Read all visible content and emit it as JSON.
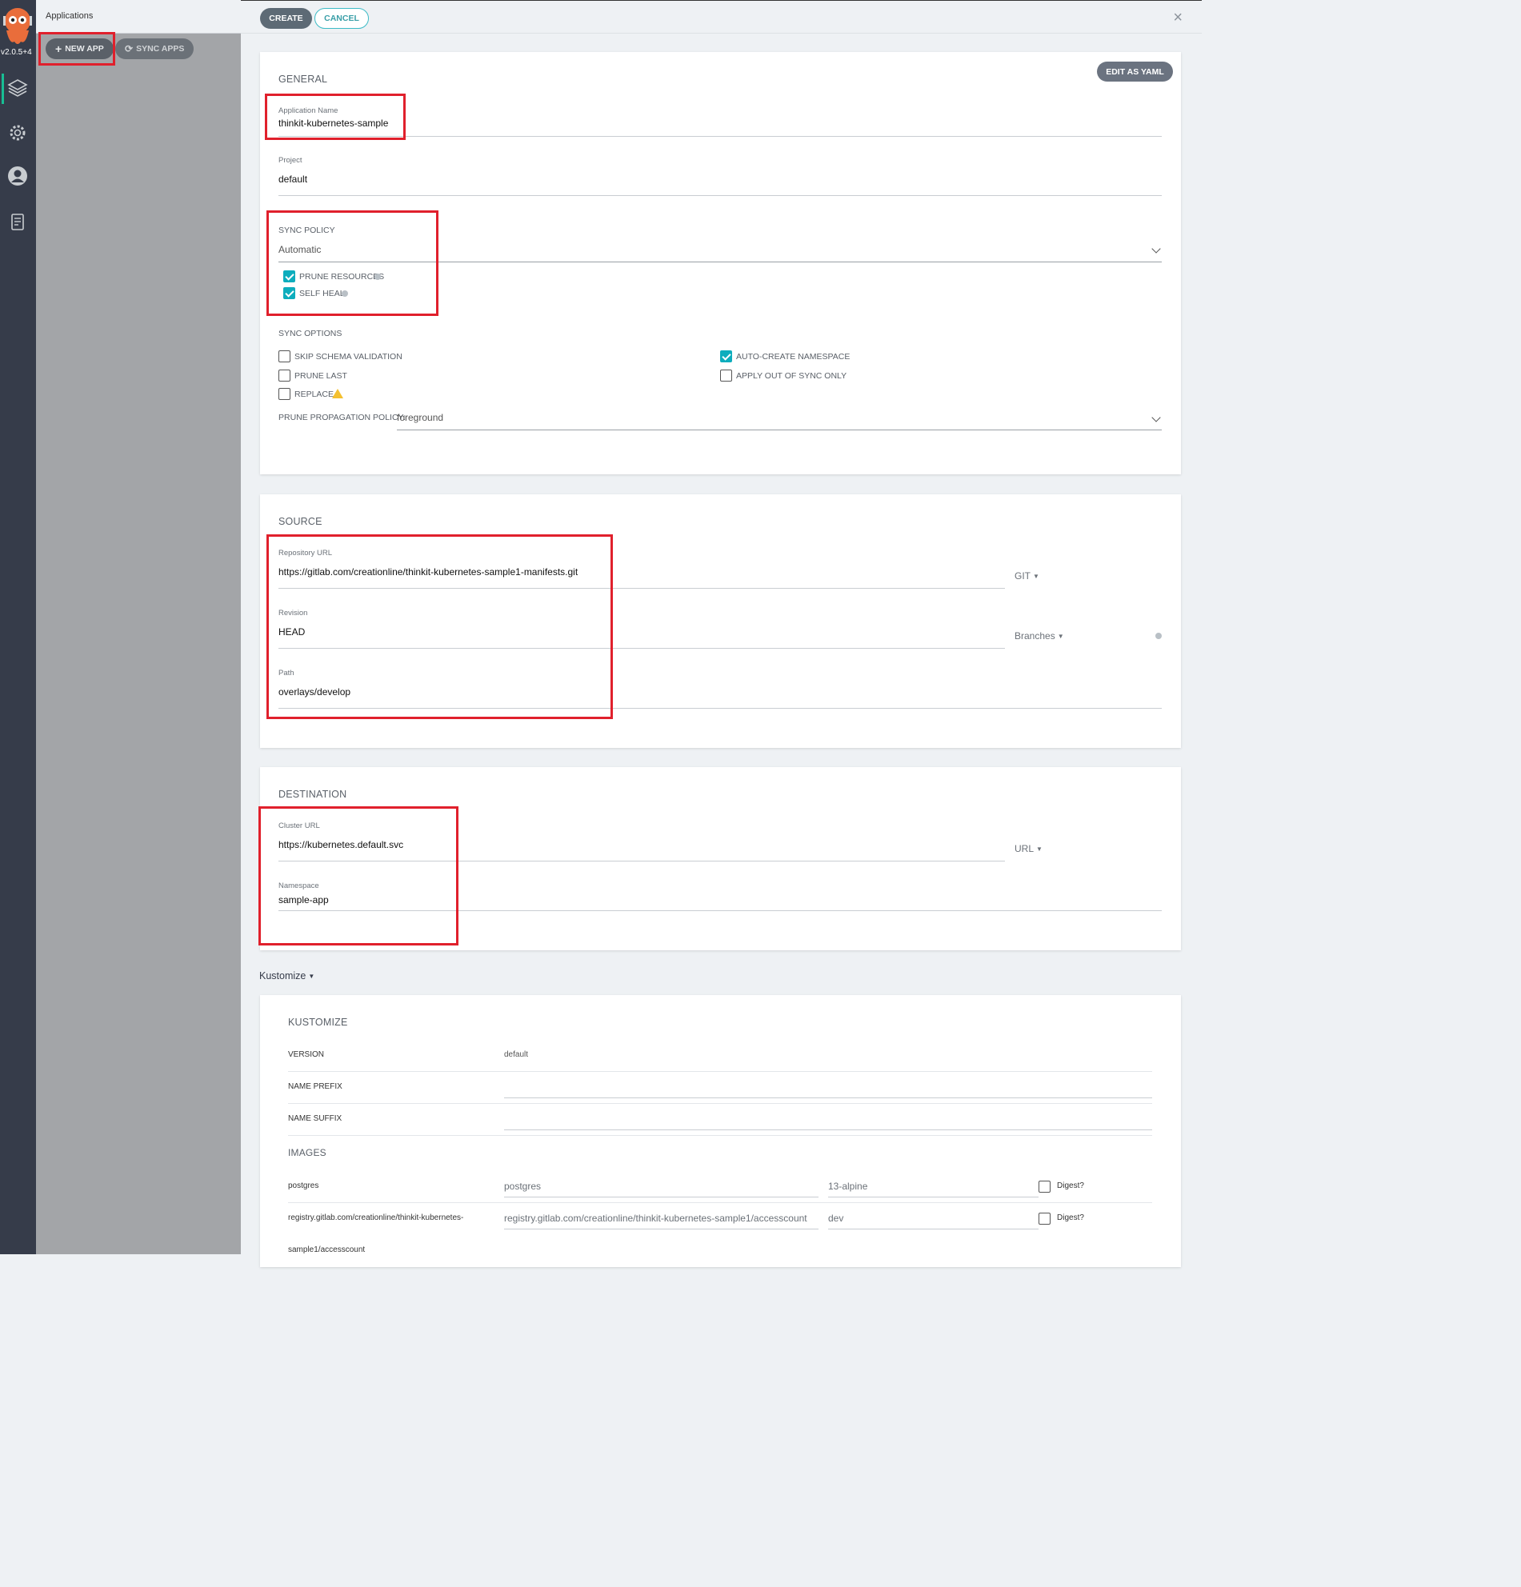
{
  "nav": {
    "version": "v2.0.5+4",
    "items": [
      {
        "name": "applications"
      },
      {
        "name": "settings"
      },
      {
        "name": "user-info"
      },
      {
        "name": "documentation"
      }
    ]
  },
  "apps_panel": {
    "title": "Applications",
    "new_app_label": "NEW APP",
    "sync_apps_label": "SYNC APPS"
  },
  "toolbar": {
    "create_label": "CREATE",
    "cancel_label": "CANCEL",
    "close_icon": "×"
  },
  "general": {
    "title": "GENERAL",
    "edit_yaml_label": "EDIT AS YAML",
    "app_name_label": "Application Name",
    "app_name_value": "thinkit-kubernetes-sample",
    "project_label": "Project",
    "project_value": "default",
    "sync_policy_label": "SYNC POLICY",
    "sync_policy_value": "Automatic",
    "prune_resources_label": "PRUNE RESOURCES",
    "self_heal_label": "SELF HEAL",
    "sync_options_label": "SYNC OPTIONS",
    "skip_schema_label": "SKIP SCHEMA VALIDATION",
    "prune_last_label": "PRUNE LAST",
    "replace_label": "REPLACE",
    "auto_create_ns_label": "AUTO-CREATE NAMESPACE",
    "apply_out_of_sync_label": "APPLY OUT OF SYNC ONLY",
    "prune_propagation_label": "PRUNE PROPAGATION POLICY:",
    "prune_propagation_value": "foreground"
  },
  "source": {
    "title": "SOURCE",
    "repo_url_label": "Repository URL",
    "repo_url_value": "https://gitlab.com/creationline/thinkit-kubernetes-sample1-manifests.git",
    "repo_type": "GIT",
    "revision_label": "Revision",
    "revision_value": "HEAD",
    "revision_type": "Branches",
    "path_label": "Path",
    "path_value": "overlays/develop"
  },
  "destination": {
    "title": "DESTINATION",
    "cluster_url_label": "Cluster URL",
    "cluster_url_value": "https://kubernetes.default.svc",
    "cluster_type": "URL",
    "namespace_label": "Namespace",
    "namespace_value": "sample-app"
  },
  "kustomize": {
    "toggle_label": "Kustomize",
    "title": "KUSTOMIZE",
    "version_label": "VERSION",
    "version_value": "default",
    "name_prefix_label": "NAME PREFIX",
    "name_suffix_label": "NAME SUFFIX",
    "images_label": "IMAGES",
    "images": [
      {
        "label": "postgres",
        "name": "postgres",
        "tag": "13-alpine",
        "digest_label": "Digest?"
      },
      {
        "label_line1": "registry.gitlab.com/creationline/thinkit-kubernetes-",
        "label_line2": "sample1/accesscount",
        "name": "registry.gitlab.com/creationline/thinkit-kubernetes-sample1/accesscount",
        "tag": "dev",
        "digest_label": "Digest?"
      }
    ]
  },
  "colors": {
    "nav_bg": "#363c4a",
    "accent_teal": "#0dadbd",
    "highlight_red": "#e0202c",
    "panel_gray": "#a3a5a8"
  }
}
